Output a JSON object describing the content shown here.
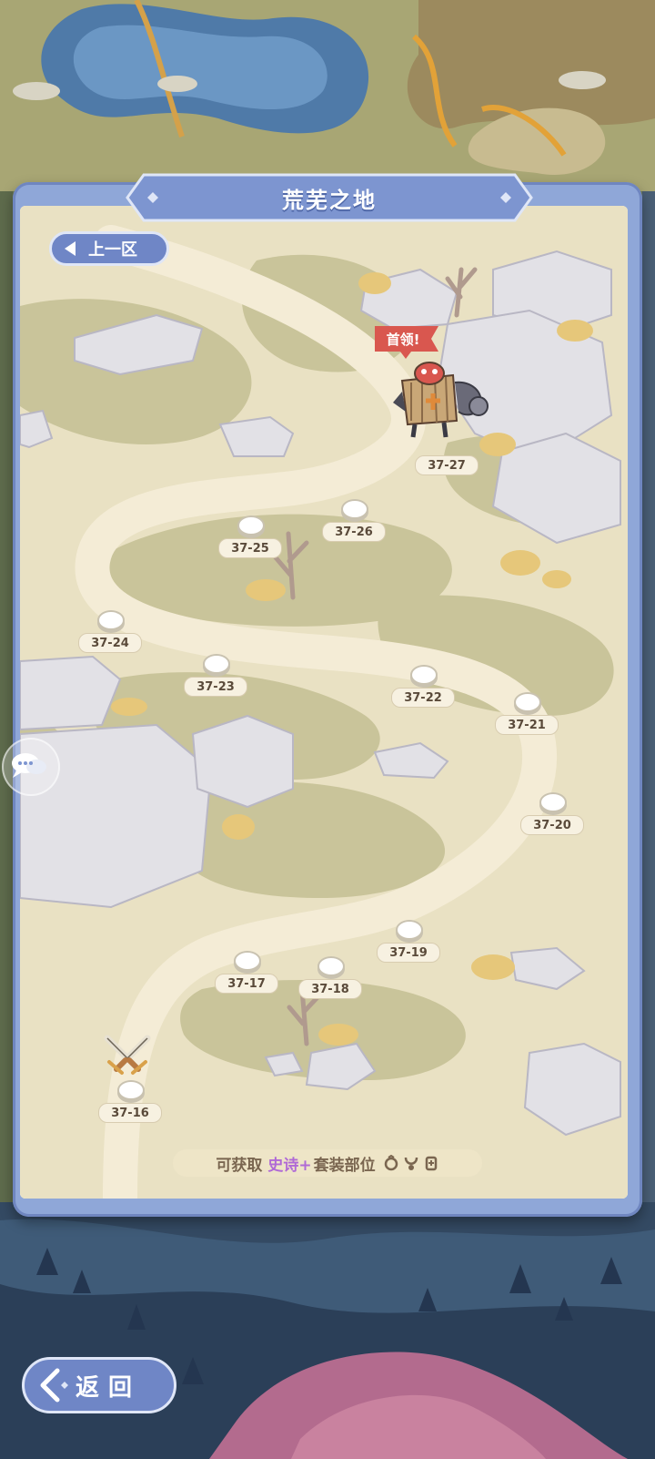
{
  "header": {
    "title": "荒芜之地"
  },
  "nav": {
    "prev_label": "上一区",
    "back_label": "返回"
  },
  "boss": {
    "badge": "首领!"
  },
  "levels": [
    {
      "id": "37-16",
      "current": true
    },
    {
      "id": "37-17"
    },
    {
      "id": "37-18"
    },
    {
      "id": "37-19"
    },
    {
      "id": "37-20"
    },
    {
      "id": "37-21"
    },
    {
      "id": "37-22"
    },
    {
      "id": "37-23"
    },
    {
      "id": "37-24"
    },
    {
      "id": "37-25"
    },
    {
      "id": "37-26"
    },
    {
      "id": "37-27",
      "boss": true
    }
  ],
  "reward": {
    "prefix": "可获取",
    "quality": "史诗+",
    "suffix": "套装部位",
    "icons": [
      "ring-icon",
      "necklace-icon",
      "charm-icon"
    ],
    "quality_color": "#b06ad6"
  },
  "icons": {
    "chat": "chat-bubbles-icon",
    "back": "back-arrow-icon",
    "current_level": "crossed-swords-icon"
  }
}
